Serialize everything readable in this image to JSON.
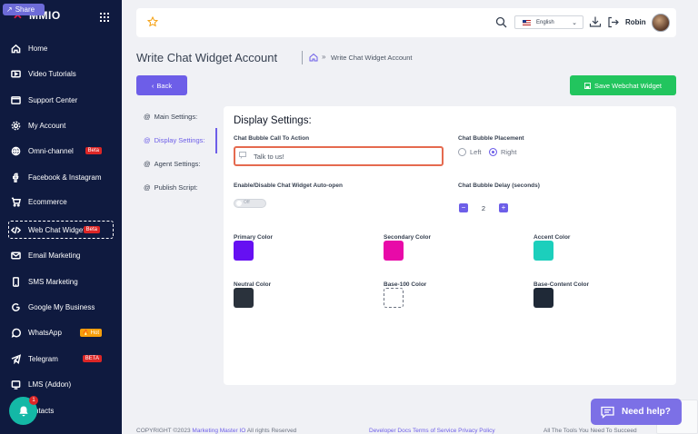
{
  "share": {
    "label": "Share"
  },
  "brand": {
    "name": "MMIO"
  },
  "sidebar": {
    "items": [
      {
        "label": "Home",
        "icon": "home-icon"
      },
      {
        "label": "Video Tutorials",
        "icon": "video-icon"
      },
      {
        "label": "Support Center",
        "icon": "support-icon"
      },
      {
        "label": "My Account",
        "icon": "gear-icon"
      },
      {
        "label": "Omni-channel",
        "icon": "globe-icon",
        "badge": "Beta"
      },
      {
        "label": "Facebook & Instagram",
        "icon": "facebook-icon"
      },
      {
        "label": "Ecommerce",
        "icon": "cart-icon"
      },
      {
        "label": "Web Chat Widget",
        "icon": "code-icon",
        "badge": "Beta"
      },
      {
        "label": "Email Marketing",
        "icon": "mail-icon"
      },
      {
        "label": "SMS Marketing",
        "icon": "phone-icon"
      },
      {
        "label": "Google My Business",
        "icon": "google-icon"
      },
      {
        "label": "WhatsApp",
        "icon": "whatsapp-icon",
        "badge": "🔥 Hot"
      },
      {
        "label": "Telegram",
        "icon": "telegram-icon",
        "badge": "BETA"
      },
      {
        "label": "LMS (Addon)",
        "icon": "lms-icon"
      },
      {
        "label": "ntacts",
        "icon": "contacts-icon"
      }
    ],
    "notification_count": "1"
  },
  "topbar": {
    "language": "English",
    "username": "Robin"
  },
  "page": {
    "title": "Write Chat Widget Account",
    "breadcrumb_current": "Write Chat Widget Account",
    "back_label": "Back",
    "save_label": "Save Webchat Widget"
  },
  "tabs": [
    {
      "label": "Main Settings:"
    },
    {
      "label": "Display Settings:"
    },
    {
      "label": "Agent Settings:"
    },
    {
      "label": "Publish Script:"
    }
  ],
  "display": {
    "heading": "Display Settings:",
    "cta_label": "Chat Bubble Call To Action",
    "cta_value": "Talk to us!",
    "placement_label": "Chat Bubble Placement",
    "placement_left": "Left",
    "placement_right": "Right",
    "placement_selected": "Right",
    "autoopen_label": "Enable/Disable Chat Widget Auto-open",
    "autoopen_state": "Off",
    "delay_label": "Chat Bubble Delay (seconds)",
    "delay_value": "2",
    "colors": [
      {
        "label": "Primary Color",
        "value": "#6610f2"
      },
      {
        "label": "Secondary Color",
        "value": "#e80aa8"
      },
      {
        "label": "Accent Color",
        "value": "#1ccfbc"
      },
      {
        "label": "Neutral Color",
        "value": "#2a323c"
      },
      {
        "label": "Base-100 Color",
        "value": "#ffffff"
      },
      {
        "label": "Base-Content Color",
        "value": "#1f2937"
      }
    ]
  },
  "footer": {
    "copyright": "COPYRIGHT ©2023",
    "company": "Marketing Master IO",
    "rights": "All rights Reserved",
    "developer_docs": "Developer Docs",
    "terms": "Terms of Service",
    "privacy": "Privacy Policy",
    "tagline": "All The Tools You Need To Succeed"
  },
  "help": {
    "label": "Need help?"
  },
  "colors": {
    "sidebar_bg": "#0f1a3f",
    "accent": "#6d5ee8",
    "success": "#22c55e",
    "badge_red": "#dc2626",
    "badge_orange": "#f59e0b"
  }
}
